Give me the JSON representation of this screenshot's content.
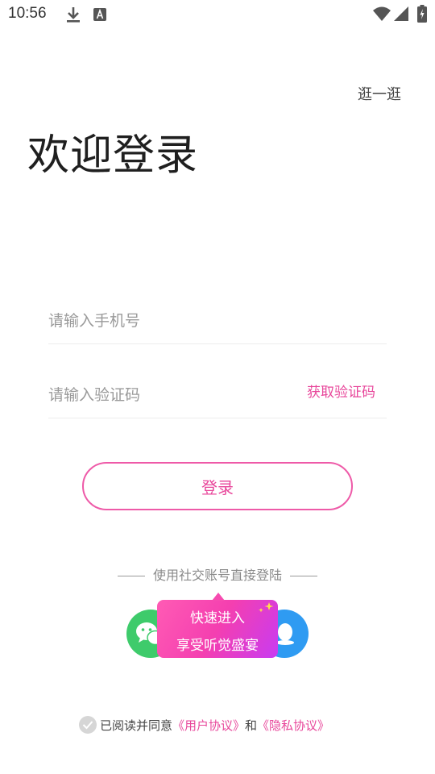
{
  "status_bar": {
    "time": "10:56",
    "icons": [
      "download-icon",
      "keyboard-a-icon",
      "wifi-icon",
      "signal-icon",
      "battery-charging-icon"
    ]
  },
  "header": {
    "browse_label": "逛一逛",
    "title": "欢迎登录"
  },
  "form": {
    "phone_placeholder": "请输入手机号",
    "phone_value": "",
    "code_placeholder": "请输入验证码",
    "code_value": "",
    "get_code_label": "获取验证码",
    "login_label": "登录"
  },
  "social": {
    "label": "使用社交账号直接登陆",
    "providers": [
      "wechat-icon",
      "qq-icon"
    ],
    "promo_line1": "快速进入",
    "promo_line2": "享受听觉盛宴"
  },
  "agreement": {
    "prefix": "已阅读并同意",
    "user_agreement": "《用户协议》",
    "conjunction": "和",
    "privacy_agreement": "《隐私协议》"
  },
  "colors": {
    "accent": "#e8479b",
    "wechat": "#3ecb6b",
    "qq": "#2f9bf2"
  }
}
